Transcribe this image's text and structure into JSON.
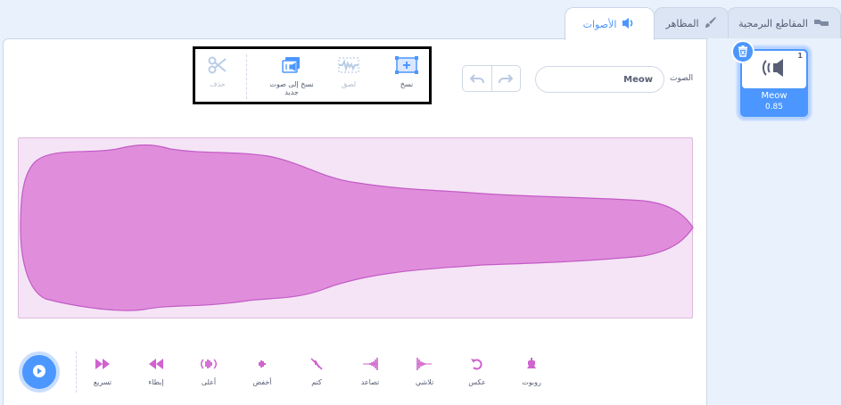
{
  "tabs": [
    {
      "key": "code",
      "label": "المقاطع البرمجية",
      "icon": "code-icon"
    },
    {
      "key": "costumes",
      "label": "المظاهر",
      "icon": "brush-icon"
    },
    {
      "key": "sounds",
      "label": "الأصوات",
      "icon": "speaker-icon",
      "active": true
    }
  ],
  "sound_list": [
    {
      "index": "1",
      "name": "Meow",
      "duration": "0.85",
      "selected": true
    }
  ],
  "editor": {
    "sound_label": "الصوت",
    "sound_name": "Meow",
    "edit_buttons": [
      {
        "key": "copy",
        "label": "نسخ",
        "enabled": true,
        "icon": "copy-icon"
      },
      {
        "key": "paste",
        "label": "لصق",
        "enabled": false,
        "icon": "paste-icon"
      },
      {
        "key": "copy-to-new",
        "label": "نسخ إلى صوت جديد",
        "enabled": true,
        "icon": "copy-to-new-icon"
      },
      {
        "key": "delete",
        "label": "حذف",
        "enabled": false,
        "icon": "scissors-icon"
      }
    ]
  },
  "effects": [
    {
      "key": "robot",
      "label": "روبوت",
      "icon": "robot-icon"
    },
    {
      "key": "reverse",
      "label": "عكس",
      "icon": "reverse-icon"
    },
    {
      "key": "fade-out",
      "label": "تلاشي",
      "icon": "fade-out-icon"
    },
    {
      "key": "fade-in",
      "label": "تصاعد",
      "icon": "fade-in-icon"
    },
    {
      "key": "mute",
      "label": "كتم",
      "icon": "mute-icon"
    },
    {
      "key": "softer",
      "label": "أخفض",
      "icon": "softer-icon"
    },
    {
      "key": "louder",
      "label": "أعلى",
      "icon": "louder-icon"
    },
    {
      "key": "slower",
      "label": "إبطاء",
      "icon": "slower-icon"
    },
    {
      "key": "faster",
      "label": "تسريع",
      "icon": "faster-icon"
    }
  ],
  "colors": {
    "accent": "#4c97ff",
    "sound_effect": "#cf63cf",
    "waveform_fill": "#e08edb",
    "waveform_bg": "#f5e4f5"
  }
}
